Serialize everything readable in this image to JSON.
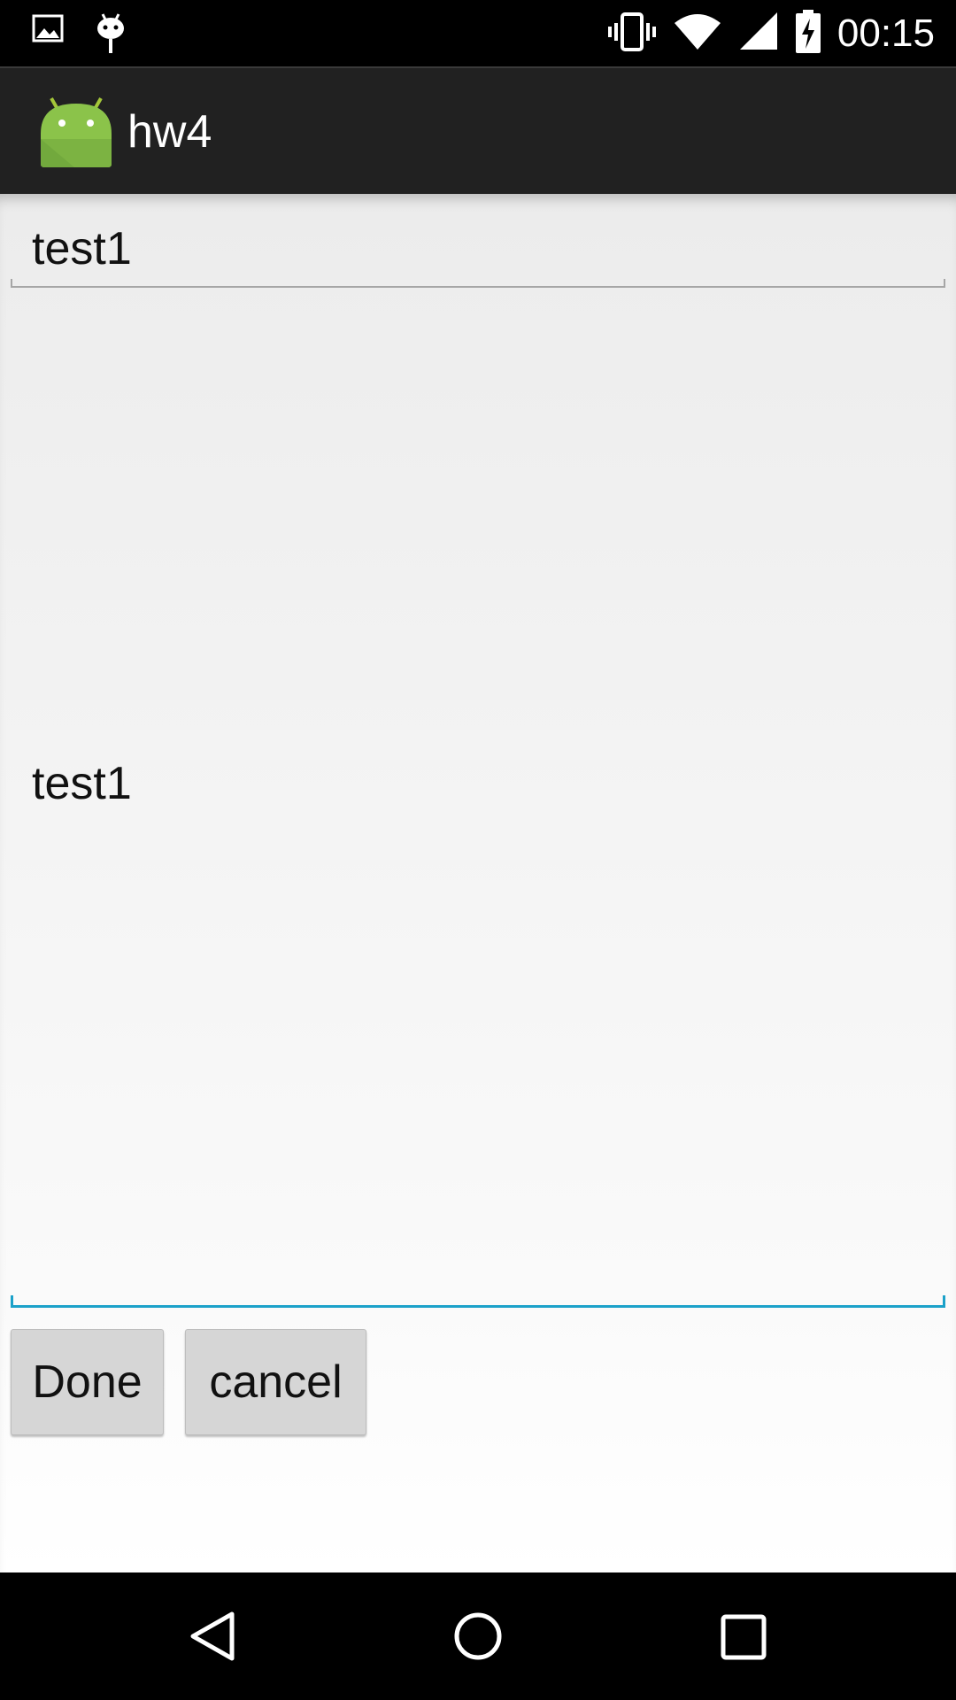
{
  "status_bar": {
    "time": "00:15",
    "icons": [
      "image-icon",
      "android-debug-icon",
      "vibrate-icon",
      "wifi-icon",
      "signal-icon",
      "battery-charging-icon"
    ]
  },
  "app_bar": {
    "title": "hw4",
    "icon": "android-app-icon"
  },
  "form": {
    "title_value": "test1",
    "body_value": "test1",
    "focused_field": "body",
    "accent_color": "#1ba1c9"
  },
  "buttons": {
    "done_label": "Done",
    "cancel_label": "cancel"
  },
  "nav_bar": {
    "icons": [
      "back-icon",
      "home-icon",
      "recents-icon"
    ]
  }
}
